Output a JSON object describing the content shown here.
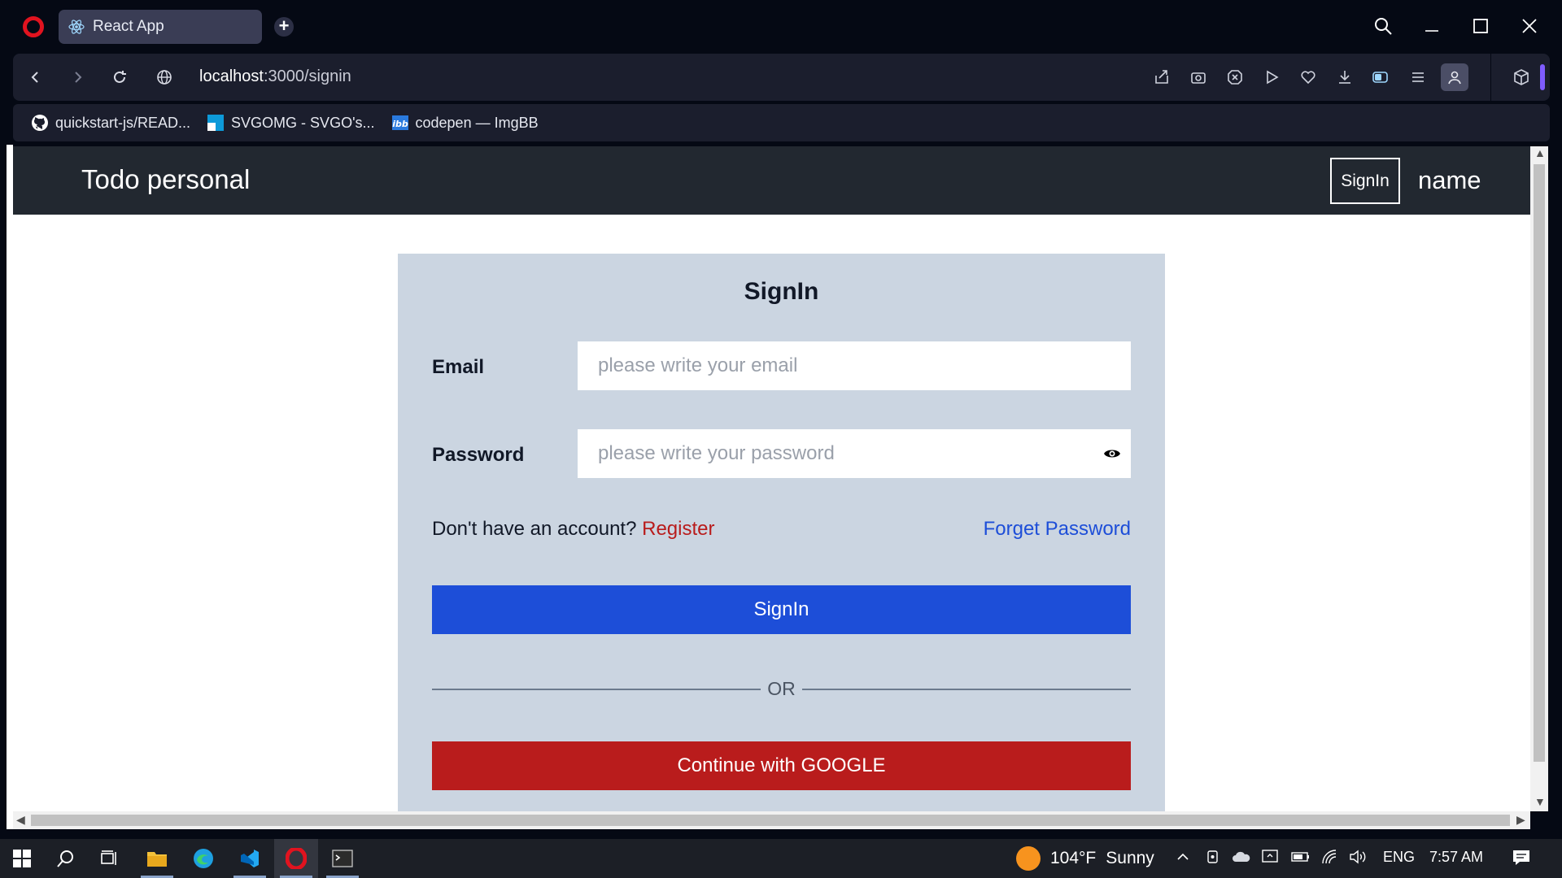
{
  "browser": {
    "tab_title": "React App",
    "url_host": "localhost",
    "url_path": ":3000/signin",
    "bookmarks": [
      {
        "label": "quickstart-js/READ...",
        "icon": "github-icon"
      },
      {
        "label": "SVGOMG - SVGO's...",
        "icon": "svgomg-icon"
      },
      {
        "label": "codepen — ImgBB",
        "icon": "imgbb-icon"
      }
    ]
  },
  "app": {
    "brand": "Todo personal",
    "nav_signin": "SignIn",
    "nav_name": "name"
  },
  "form": {
    "title": "SignIn",
    "email_label": "Email",
    "email_placeholder": "please write your email",
    "password_label": "Password",
    "password_placeholder": "please write your password",
    "account_prompt": "Don't have an account?",
    "register_link": "Register",
    "forget_link": "Forget Password",
    "signin_button": "SignIn",
    "or_text": "OR",
    "google_button": "Continue with GOOGLE"
  },
  "taskbar": {
    "temperature": "104°F",
    "weather": "Sunny",
    "language": "ENG",
    "time": "7:57 AM"
  },
  "colors": {
    "nav_bg": "#222830",
    "card_bg": "#cbd5e1",
    "primary": "#1d4ed8",
    "danger": "#b91c1c"
  }
}
